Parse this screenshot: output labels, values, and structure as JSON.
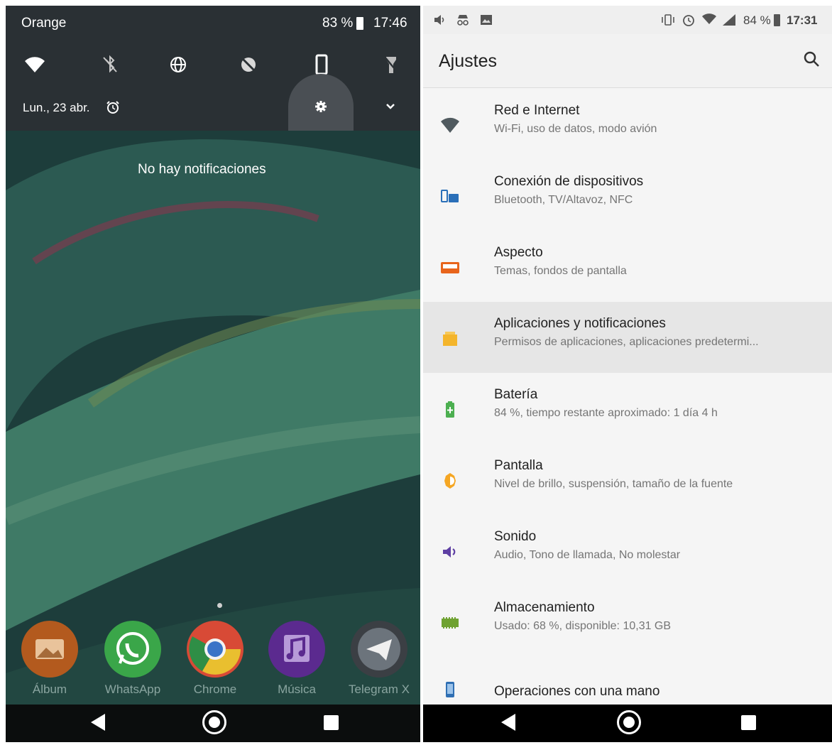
{
  "left_phone": {
    "status": {
      "carrier": "Orange",
      "battery_pct": "83 %",
      "time": "17:46"
    },
    "quick_settings": [
      "wifi-icon",
      "bluetooth-off-icon",
      "globe-icon",
      "sync-off-icon",
      "rotation-icon",
      "flashlight-off-icon"
    ],
    "date": "Lun., 23 abr.",
    "no_notifications": "No hay notificaciones",
    "dock": [
      {
        "label": "Álbum",
        "icon": "album-icon",
        "color": "#b35a1e"
      },
      {
        "label": "WhatsApp",
        "icon": "whatsapp-icon",
        "color": "#3aa649"
      },
      {
        "label": "Chrome",
        "icon": "chrome-icon",
        "color": "#d84a36"
      },
      {
        "label": "Música",
        "icon": "music-icon",
        "color": "#5b2a8f"
      },
      {
        "label": "Telegram X",
        "icon": "telegram-icon",
        "color": "#3b3f44"
      }
    ]
  },
  "right_phone": {
    "status": {
      "battery_pct": "84 %",
      "time": "17:31"
    },
    "title": "Ajustes",
    "items": [
      {
        "title": "Red e Internet",
        "subtitle": "Wi-Fi, uso de datos, modo avión",
        "icon": "wifi-icon",
        "color": "#505a5f"
      },
      {
        "title": "Conexión de dispositivos",
        "subtitle": "Bluetooth, TV/Altavoz, NFC",
        "icon": "devices-icon",
        "color": "#2a6fb8"
      },
      {
        "title": "Aspecto",
        "subtitle": "Temas, fondos de pantalla",
        "icon": "theme-icon",
        "color": "#e8641b"
      },
      {
        "title": "Aplicaciones y notificaciones",
        "subtitle": "Permisos de aplicaciones, aplicaciones predetermi...",
        "icon": "apps-icon",
        "color": "#f4b52c"
      },
      {
        "title": "Batería",
        "subtitle": "84 %, tiempo restante aproximado: 1 día 4 h",
        "icon": "battery-icon",
        "color": "#4caf50"
      },
      {
        "title": "Pantalla",
        "subtitle": "Nivel de brillo, suspensión, tamaño de la fuente",
        "icon": "brightness-icon",
        "color": "#f5a623"
      },
      {
        "title": "Sonido",
        "subtitle": "Audio, Tono de llamada, No molestar",
        "icon": "sound-icon",
        "color": "#5e3fa3"
      },
      {
        "title": "Almacenamiento",
        "subtitle": "Usado: 68 %, disponible: 10,31 GB",
        "icon": "storage-icon",
        "color": "#6fa232"
      },
      {
        "title": "Operaciones con una mano",
        "subtitle": "",
        "icon": "one-hand-icon",
        "color": "#2f6fb3"
      }
    ]
  }
}
